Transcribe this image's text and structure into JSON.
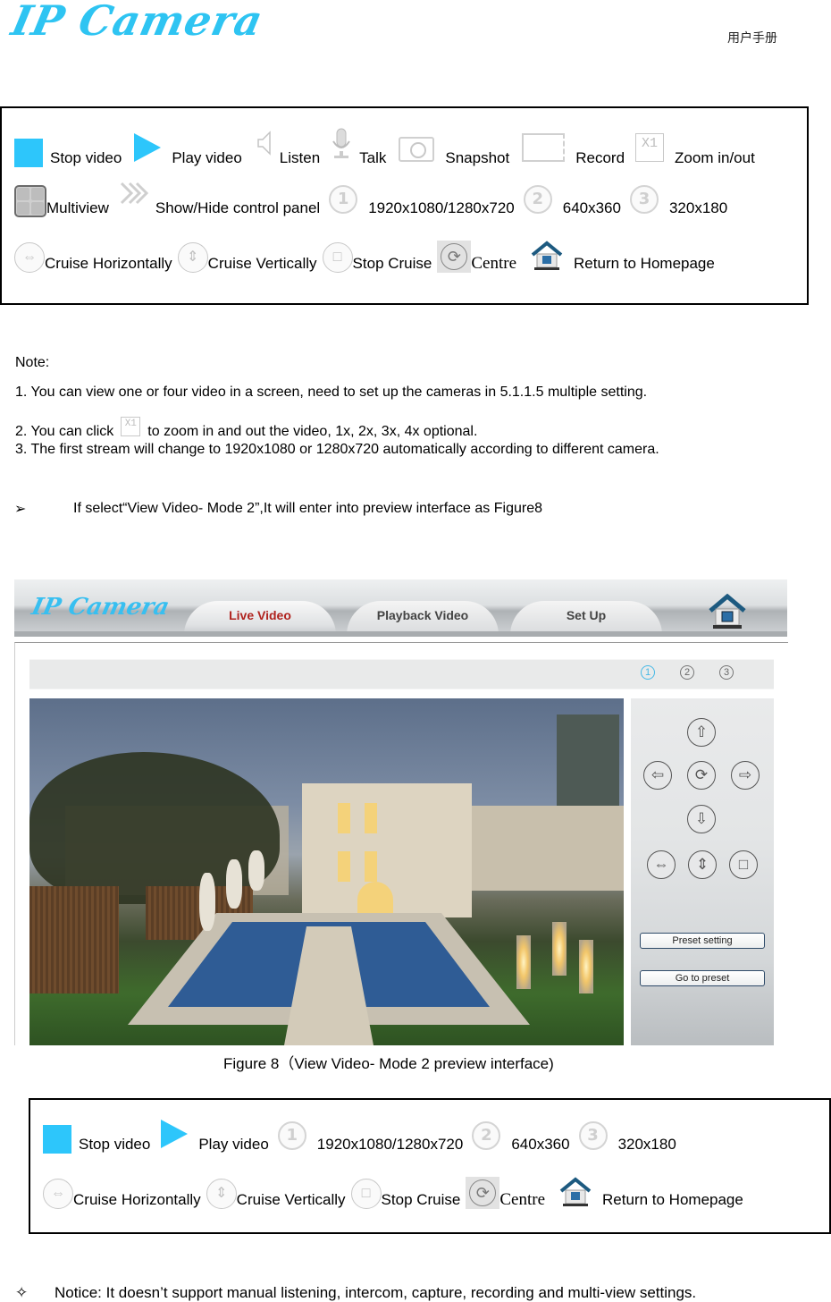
{
  "header": {
    "logo": "IP Camera",
    "manual_label": "用户手册"
  },
  "legend_top": {
    "rows": [
      [
        {
          "icon": "stop-square-icon",
          "label": "Stop  video"
        },
        {
          "icon": "play-triangle-icon",
          "label": "Play  video"
        },
        {
          "icon": "speaker-icon",
          "label": "Listen"
        },
        {
          "icon": "microphone-icon",
          "label": "Talk"
        },
        {
          "icon": "camera-icon",
          "label": "Snapshot"
        },
        {
          "icon": "video-record-icon",
          "label": "Record"
        },
        {
          "icon": "zoom-x1-icon",
          "label": "Zoom  in/out",
          "glyph": "X1"
        }
      ],
      [
        {
          "icon": "multiview-grid-icon",
          "label": "Multiview"
        },
        {
          "icon": "double-chevron-icon",
          "label": "Show/Hide control panel"
        },
        {
          "icon": "circle-1-icon",
          "label": "1920x1080/1280x720",
          "glyph": "1"
        },
        {
          "icon": "circle-2-icon",
          "label": "640x360",
          "glyph": "2"
        },
        {
          "icon": "circle-3-icon",
          "label": "320x180",
          "glyph": "3"
        }
      ],
      [
        {
          "icon": "cruise-horizontal-icon",
          "label": "Cruise Horizontally"
        },
        {
          "icon": "cruise-vertical-icon",
          "label": "Cruise Vertically"
        },
        {
          "icon": "stop-cruise-icon",
          "label": "Stop Cruise"
        },
        {
          "icon": "centre-icon",
          "label": "Centre"
        },
        {
          "icon": "home-icon",
          "label": "Return to Homepage"
        }
      ]
    ]
  },
  "notes": {
    "heading": "Note:",
    "items": [
      "1.  You can view one or four video in a screen, need to set up the cameras in 5.1.1.5 multiple setting.",
      "2.  You can click",
      "3.  The first stream will change to 1920x1080 or 1280x720 automatically according to different camera."
    ],
    "item2_suffix": "to zoom in and out the video, 1x, 2x, 3x, 4x optional.",
    "item2_icon_glyph": "X1",
    "bullet_glyph": "➢",
    "bullet_text": "If select“View Video- Mode 2”,It will enter into preview interface as Figure8"
  },
  "figure": {
    "logo": "IP Camera",
    "tabs": [
      {
        "label": "Live Video",
        "active": true
      },
      {
        "label": "Playback Video",
        "active": false
      },
      {
        "label": "Set Up",
        "active": false
      }
    ],
    "stream_buttons": [
      "1",
      "2",
      "3"
    ],
    "active_stream": "1",
    "ptz": {
      "up": "⇧",
      "left": "⇦",
      "centre": "⟳",
      "right": "⇨",
      "down": "⇩",
      "cruise_h": "⇔",
      "cruise_v": "⇕",
      "stop": "□"
    },
    "preset_setting": "Preset setting",
    "go_to_preset": "Go to preset",
    "caption": "Figure 8（View Video- Mode 2 preview interface)"
  },
  "legend_bottom": {
    "rows": [
      [
        {
          "icon": "stop-square-icon",
          "label": "Stop video"
        },
        {
          "icon": "play-triangle-icon",
          "label": "Play video"
        },
        {
          "icon": "circle-1-icon",
          "label": "1920x1080/1280x720",
          "glyph": "1"
        },
        {
          "icon": "circle-2-icon",
          "label": "640x360",
          "glyph": "2"
        },
        {
          "icon": "circle-3-icon",
          "label": "320x180",
          "glyph": "3"
        }
      ],
      [
        {
          "icon": "cruise-horizontal-icon",
          "label": "Cruise Horizontally"
        },
        {
          "icon": "cruise-vertical-icon",
          "label": "Cruise Vertically"
        },
        {
          "icon": "stop-cruise-icon",
          "label": "Stop Cruise"
        },
        {
          "icon": "centre-icon",
          "label": "Centre"
        },
        {
          "icon": "home-icon",
          "label": "Return to Homepage"
        }
      ]
    ]
  },
  "notice": {
    "glyph": "✧",
    "text": "Notice: It doesn’t support manual listening, intercom, capture, recording and multi-view settings."
  },
  "colors": {
    "accent_blue": "#2dc6fb",
    "active_tab_text": "#b0231e"
  }
}
